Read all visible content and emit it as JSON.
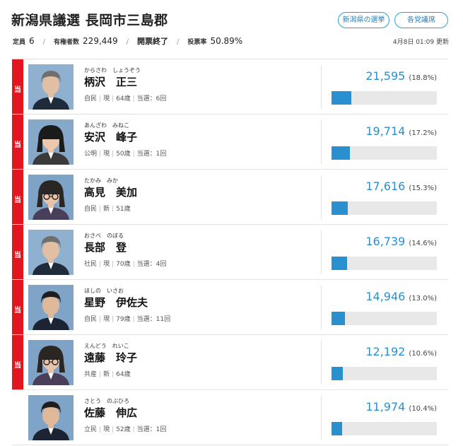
{
  "header": {
    "title": "新潟県議選 長岡市三島郡",
    "buttons": [
      "新潟県の選挙",
      "各党議席"
    ]
  },
  "stats": {
    "seats_label": "定員",
    "seats": "6",
    "voters_label": "有権者数",
    "voters": "229,449",
    "status": "開票終了",
    "turnout_label": "投票率",
    "turnout": "50.89%",
    "updated": "4月8日 01:09 更新"
  },
  "elected_mark": "当",
  "colors": {
    "accent": "#2a8fcf",
    "elected": "#e3151e",
    "bar_bg": "#e8e8e8"
  },
  "candidates": [
    {
      "kana": "からさわ　しょうぞう",
      "name": "柄沢　正三",
      "party": "自民",
      "status": "現",
      "age": "64歳",
      "terms": "当選：6回",
      "votes": "21,595",
      "pct": "(18.8%)",
      "share": 0.188,
      "elected": true,
      "photo": "candidate-photo-man-gray-hair"
    },
    {
      "kana": "あんざわ　みねこ",
      "name": "安沢　峰子",
      "party": "公明",
      "status": "現",
      "age": "50歳",
      "terms": "当選：1回",
      "votes": "19,714",
      "pct": "(17.2%)",
      "share": 0.172,
      "elected": true,
      "photo": "candidate-photo-woman-short-hair"
    },
    {
      "kana": "たかみ　みか",
      "name": "高見　美加",
      "party": "自民",
      "status": "新",
      "age": "51歳",
      "terms": "",
      "votes": "17,616",
      "pct": "(15.3%)",
      "share": 0.153,
      "elected": true,
      "photo": "candidate-photo-woman-glasses"
    },
    {
      "kana": "おさべ　のぼる",
      "name": "長部　登",
      "party": "社民",
      "status": "現",
      "age": "70歳",
      "terms": "当選：4回",
      "votes": "16,739",
      "pct": "(14.6%)",
      "share": 0.146,
      "elected": true,
      "photo": "candidate-photo-man-gray-hair"
    },
    {
      "kana": "ほしの　いさお",
      "name": "星野　伊佐夫",
      "party": "自民",
      "status": "現",
      "age": "79歳",
      "terms": "当選：11回",
      "votes": "14,946",
      "pct": "(13.0%)",
      "share": 0.13,
      "elected": true,
      "photo": "candidate-photo-man-dark-hair"
    },
    {
      "kana": "えんどう　れいこ",
      "name": "遠藤　玲子",
      "party": "共産",
      "status": "新",
      "age": "64歳",
      "terms": "",
      "votes": "12,192",
      "pct": "(10.6%)",
      "share": 0.106,
      "elected": true,
      "photo": "candidate-photo-woman-glasses"
    },
    {
      "kana": "さとう　のぶひろ",
      "name": "佐藤　伸広",
      "party": "立民",
      "status": "現",
      "age": "52歳",
      "terms": "当選：1回",
      "votes": "11,974",
      "pct": "(10.4%)",
      "share": 0.104,
      "elected": false,
      "photo": "candidate-photo-man-dark-hair"
    }
  ]
}
